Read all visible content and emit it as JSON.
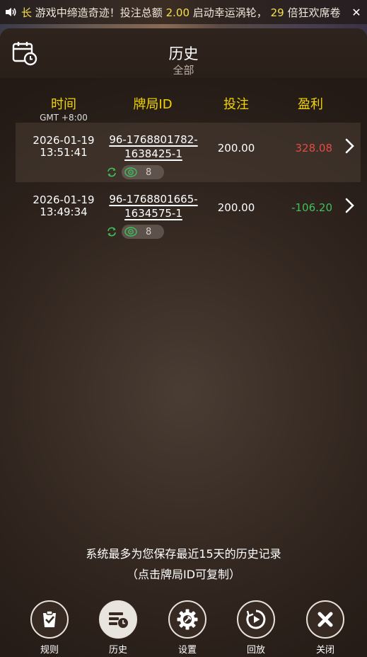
{
  "marquee": {
    "prefix": "长",
    "t1": "游戏中缔造奇迹！投注总额",
    "v1": "2.00",
    "t2": "启动幸运涡轮，",
    "v2": "29",
    "t3": "倍狂欢席卷"
  },
  "header": {
    "title": "历史",
    "subtitle": "全部"
  },
  "table": {
    "col_time": "时间",
    "col_time_tz": "GMT +8:00",
    "col_id": "牌局ID",
    "col_bet": "投注",
    "col_profit": "盈利"
  },
  "rows": [
    {
      "date": "2026-01-19",
      "time": "13:51:41",
      "id_line1": "96-1768801782-",
      "id_line2": "1638425-1",
      "bet": "200.00",
      "profit": "328.08",
      "count": "8"
    },
    {
      "date": "2026-01-19",
      "time": "13:49:34",
      "id_line1": "96-1768801665-",
      "id_line2": "1634575-1",
      "bet": "200.00",
      "profit": "-106.20",
      "count": "8"
    }
  ],
  "footer": {
    "note1": "系统最多为您保存最近15天的历史记录",
    "note2": "（点击牌局ID可复制）"
  },
  "nav": {
    "rules": "规则",
    "history": "历史",
    "settings": "设置",
    "replay": "回放",
    "close": "关闭"
  },
  "colors": {
    "accent_yellow": "#f3d400",
    "profit_positive": "#e24a43",
    "profit_negative": "#3fc05a"
  }
}
